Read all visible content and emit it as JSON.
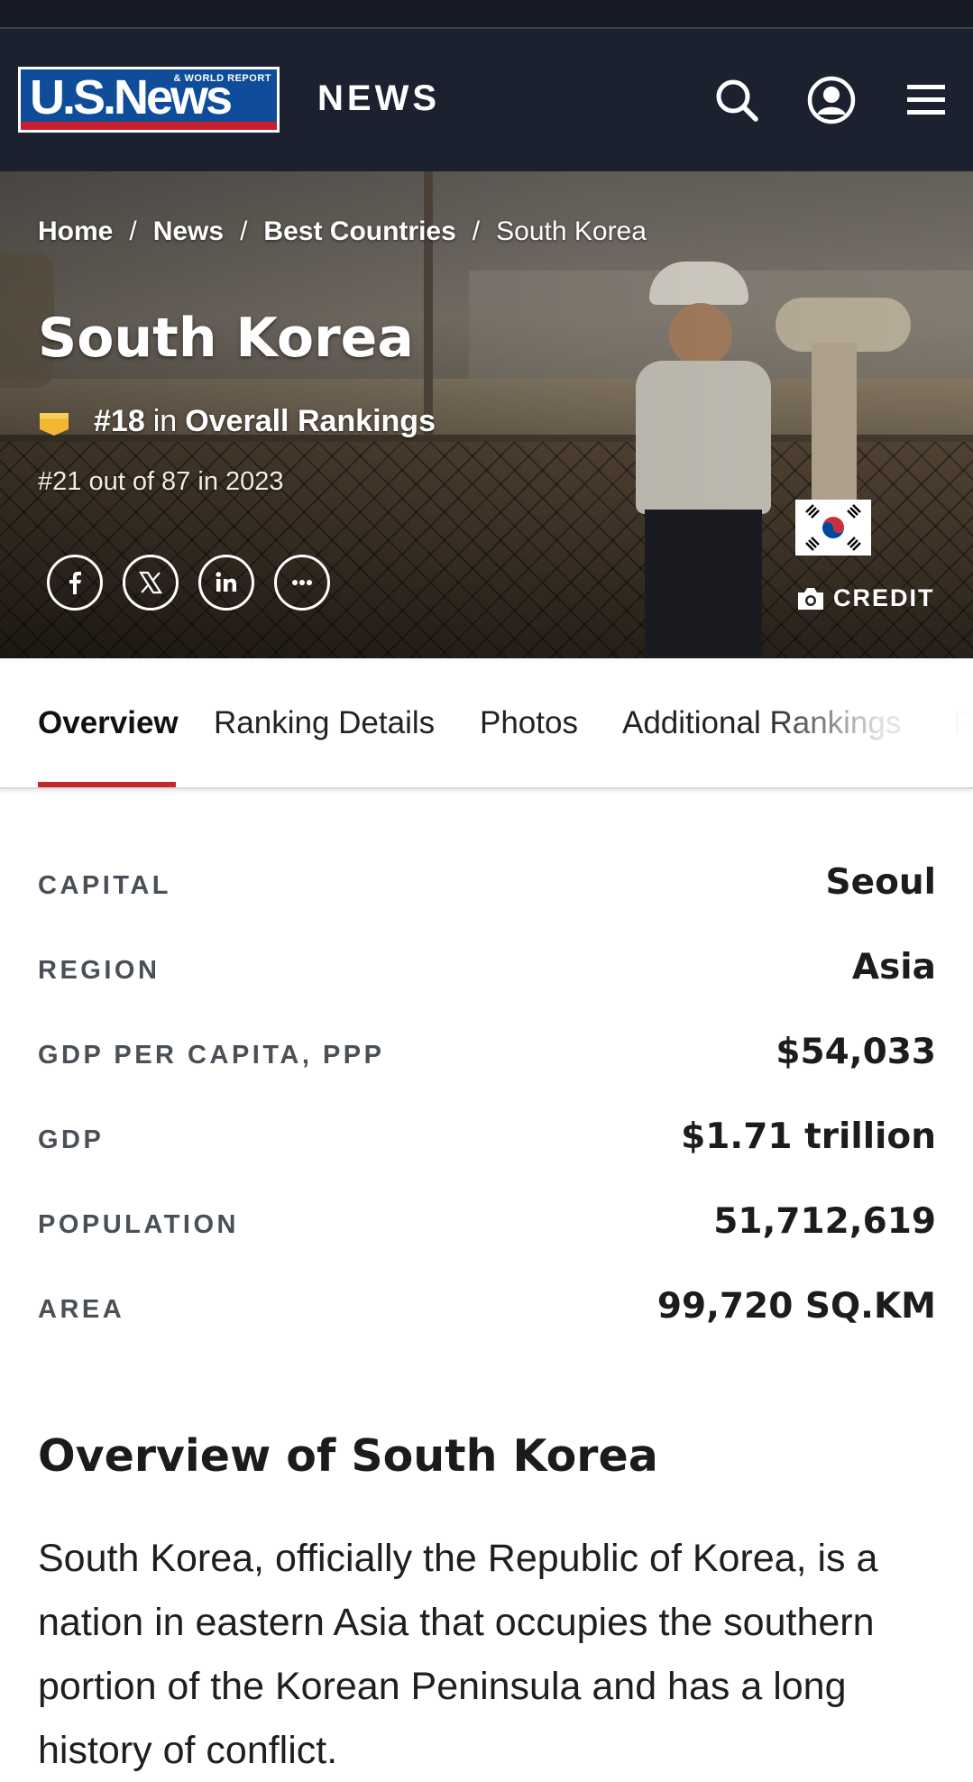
{
  "header": {
    "logo_main": "U.S.News",
    "logo_sub": "& WORLD REPORT",
    "section_title": "NEWS",
    "icons": [
      "search-icon",
      "account-icon",
      "menu-icon"
    ]
  },
  "breadcrumb": {
    "items": [
      "Home",
      "News",
      "Best Countries"
    ],
    "separator": "/",
    "current": "South Korea"
  },
  "hero": {
    "title": "South Korea",
    "rank_number": "#18",
    "rank_in": "in",
    "rank_category": "Overall Rankings",
    "prior_rank": "#21 out of 87 in 2023",
    "credit_label": "CREDIT",
    "social_icons": [
      "facebook-icon",
      "x-icon",
      "linkedin-icon",
      "more-icon"
    ]
  },
  "tabs": [
    {
      "label": "Overview",
      "active": true
    },
    {
      "label": "Ranking Details",
      "active": false
    },
    {
      "label": "Photos",
      "active": false
    },
    {
      "label": "Additional Rankings",
      "active": false
    },
    {
      "label": "R",
      "active": false
    }
  ],
  "facts": [
    {
      "label": "CAPITAL",
      "value": "Seoul"
    },
    {
      "label": "REGION",
      "value": "Asia"
    },
    {
      "label": "GDP PER CAPITA, PPP",
      "value": "$54,033"
    },
    {
      "label": "GDP",
      "value": "$1.71 trillion"
    },
    {
      "label": "POPULATION",
      "value": "51,712,619"
    },
    {
      "label": "AREA",
      "value": "99,720 SQ.KM"
    }
  ],
  "overview": {
    "heading": "Overview of South Korea",
    "text": "South Korea, officially the Republic of Korea, is a nation in eastern Asia that occupies the southern portion of the Korean Peninsula and has a long history of conflict."
  },
  "colors": {
    "header_bg": "#1c2130",
    "logo_blue": "#0f4d9a",
    "logo_red": "#c8202f",
    "tab_accent": "#c1272d",
    "badge_gold": "#f2b632"
  }
}
